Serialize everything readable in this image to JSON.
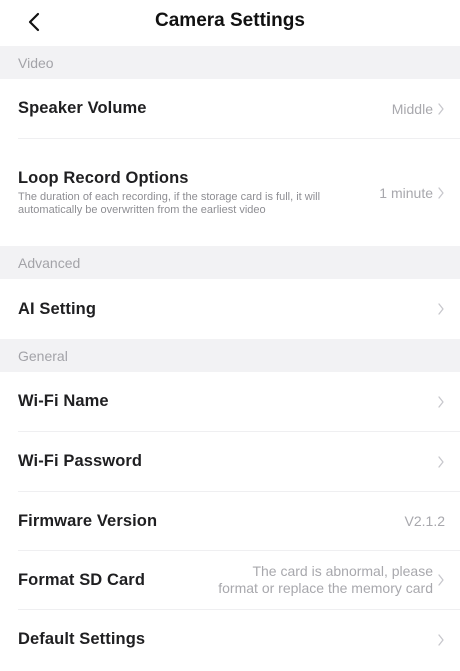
{
  "header": {
    "title": "Camera Settings",
    "back_icon": "chevron-left-icon"
  },
  "sections": {
    "video": {
      "label": "Video",
      "speaker_volume": {
        "title": "Speaker Volume",
        "value": "Middle"
      },
      "loop_record": {
        "title": "Loop Record Options",
        "description": "The duration of each recording, if the storage card is full, it will automatically be overwritten from the earliest video",
        "value": "1 minute"
      }
    },
    "advanced": {
      "label": "Advanced",
      "ai_setting": {
        "title": "AI Setting"
      }
    },
    "general": {
      "label": "General",
      "wifi_name": {
        "title": "Wi-Fi Name"
      },
      "wifi_password": {
        "title": "Wi-Fi Password"
      },
      "firmware": {
        "title": "Firmware Version",
        "value": "V2.1.2"
      },
      "format_sd": {
        "title": "Format SD Card",
        "value_line1": "The card is abnormal, please",
        "value_line2": "format or replace the memory card"
      },
      "default_settings": {
        "title": "Default Settings"
      }
    }
  },
  "colors": {
    "section_bg": "#f2f2f4",
    "section_text": "#a3a3a8",
    "value_text": "#a8a8ad",
    "chevron": "#c7c7cc"
  }
}
